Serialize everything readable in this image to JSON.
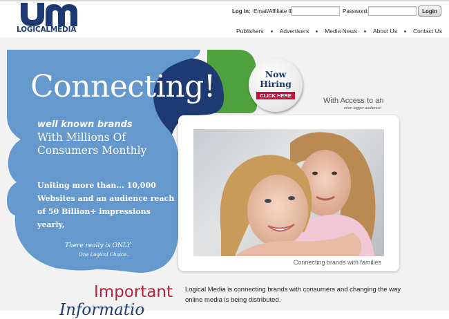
{
  "brand": {
    "name": "LOGICALMEDIA",
    "logo_icon": "um-logo-mark",
    "colors": {
      "navy": "#1e3a73",
      "blue": "#6598cc",
      "green": "#4ea13c",
      "red": "#c5143c"
    }
  },
  "login": {
    "label": "Log In:",
    "id_label": "Email/Affiliate ID:",
    "id_value": "",
    "password_label": "Password:",
    "password_value": "",
    "button_label": "Login"
  },
  "nav": {
    "items": [
      {
        "label": "Publishers"
      },
      {
        "label": "Advertisers"
      },
      {
        "label": "Media News"
      },
      {
        "label": "About Us"
      },
      {
        "label": "Contact Us"
      }
    ]
  },
  "hero": {
    "headline": "Connecting!",
    "subhead": "well known brands",
    "tagline": "With Millions Of Consumers Monthly",
    "uniting": "Uniting more than... 10,000 Websites and an audience reach of 50 Billion+ impressions yearly,",
    "only_line1": "There really is ONLY",
    "only_line2": "One Logical Choice..",
    "badge_line1": "Now",
    "badge_line2": "Hiring",
    "badge_click": "CLICK HERE",
    "access_line1": "With Access to an",
    "access_line2": "even bigger audience!",
    "photo_caption": "Connecting brands with families"
  },
  "bottom": {
    "important": "Important",
    "information": "Informatio",
    "about_text": "Logical Media is connecting brands with consumers and changing the way online media is being distributed."
  }
}
